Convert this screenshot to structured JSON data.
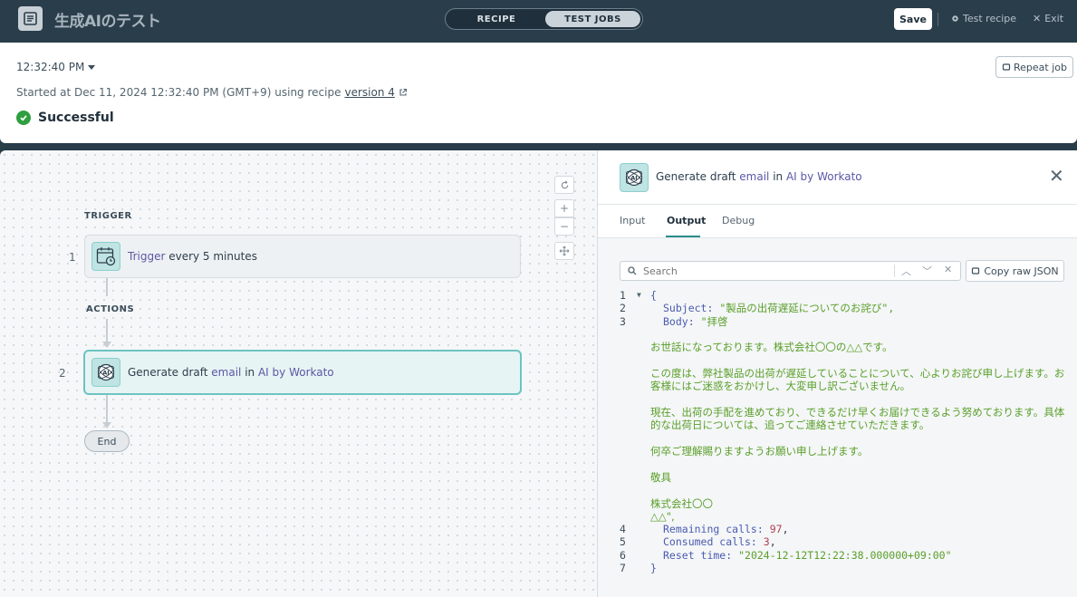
{
  "topbar": {
    "app_title": "生成AIのテスト",
    "tab_recipe": "RECIPE",
    "tab_test_jobs": "TEST JOBS",
    "save_label": "Save",
    "test_recipe_label": "Test recipe",
    "exit_label": "Exit"
  },
  "job": {
    "time": "12:32:40 PM",
    "repeat_label": "Repeat job",
    "started_text": "Started at Dec 11, 2024 12:32:40 PM (GMT+9) using recipe",
    "version_label": "version 4",
    "status": "Successful"
  },
  "canvas": {
    "trigger_header": "TRIGGER",
    "actions_header": "ACTIONS",
    "steps": [
      {
        "num": "1",
        "link": "Trigger",
        "text": " every 5 minutes"
      },
      {
        "num": "2",
        "prefix": "Generate draft ",
        "link1": "email",
        "mid": " in ",
        "link2": "AI by Workato"
      }
    ],
    "end_label": "End",
    "zoom_in": "+",
    "zoom_out": "−"
  },
  "panel": {
    "title_prefix": "Generate draft ",
    "title_link1": "email",
    "title_mid": " in ",
    "title_link2": "AI by Workato",
    "tabs": [
      "Input",
      "Output",
      "Debug"
    ],
    "search_placeholder": "Search",
    "copy_label": "Copy raw JSON"
  },
  "output_json": {
    "line_numbers": [
      "1",
      "2",
      "3",
      "4",
      "5",
      "6",
      "7"
    ],
    "open_brace": "{",
    "close_brace": "}",
    "subject_key": "Subject:",
    "subject_value": "\"製品の出荷遅延についてのお詫び\",",
    "body_key": "Body:",
    "body_first": "\"拝啓",
    "body_para1": "お世話になっております。株式会社〇〇の△△です。",
    "body_para2": "この度は、弊社製品の出荷が遅延していることについて、心よりお詫び申し上げます。お客様にはご迷惑をおかけし、大変申し訳ございません。",
    "body_para3": "現在、出荷の手配を進めており、できるだけ早くお届けできるよう努めております。具体的な出荷日については、追ってご連絡させていただきます。",
    "body_para4": "何卒ご理解賜りますようお願い申し上げます。",
    "body_para5": "敬具",
    "body_sig1": "株式会社〇〇",
    "body_sig2": "△△\",",
    "remaining_key": "Remaining calls:",
    "remaining_value": "97",
    "consumed_key": "Consumed calls:",
    "consumed_value": "3",
    "reset_key": "Reset time:",
    "reset_value": "\"2024-12-12T12:22:38.000000+09:00\""
  }
}
